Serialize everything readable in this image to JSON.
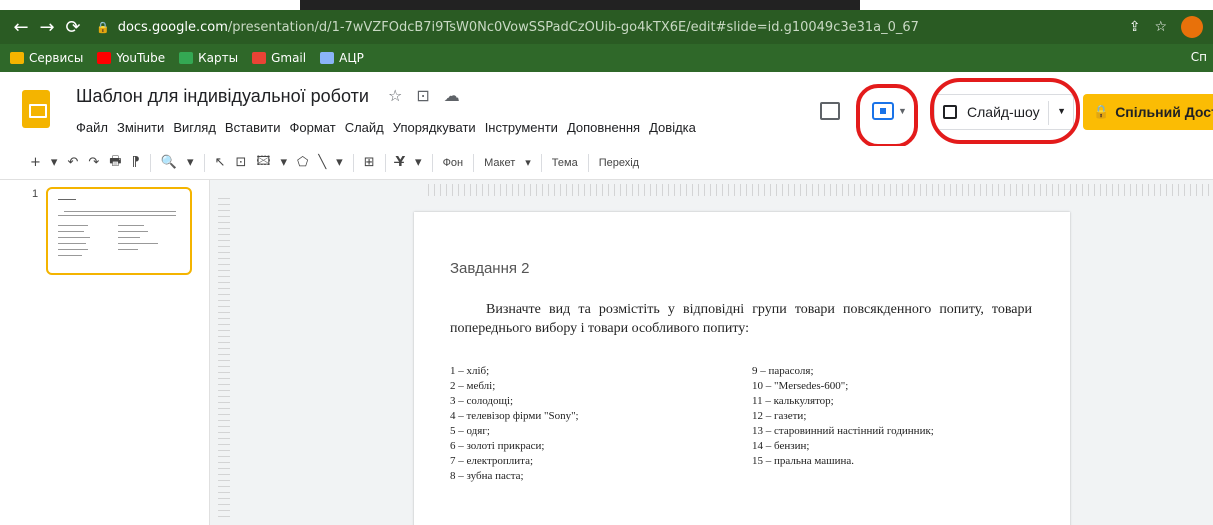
{
  "browser": {
    "url_host": "docs.google.com",
    "url_path": "/presentation/d/1-7wVZFOdcB7i9TsW0Nc0VowSSPadCzOUib-go4kTX6E/edit#slide=id.g10049c3e31a_0_67",
    "bookmarks": [
      {
        "label": "Сервисы",
        "icon": "apps-icon",
        "color": "#f4b400"
      },
      {
        "label": "YouTube",
        "icon": "youtube-icon",
        "color": "#ff0000"
      },
      {
        "label": "Карты",
        "icon": "maps-icon",
        "color": "#34a853"
      },
      {
        "label": "Gmail",
        "icon": "gmail-icon",
        "color": "#ea4335"
      },
      {
        "label": "АЦР",
        "icon": "site-icon",
        "color": "#8ab4f8"
      }
    ],
    "bookmarks_right_label": "Сп"
  },
  "docs": {
    "title": "Шаблон для індивідуальної роботи",
    "menu": [
      "Файл",
      "Змінити",
      "Вигляд",
      "Вставити",
      "Формат",
      "Слайд",
      "Упорядкувати",
      "Інструменти",
      "Доповнення",
      "Довідка"
    ],
    "slideshow_label": "Слайд-шоу",
    "share_label": "Спільний Досту",
    "accent": "#f4b400",
    "annotation_color": "#e31b1b"
  },
  "toolbar": {
    "glyphs": [
      "+",
      "▾",
      "↶",
      "↷",
      "🖶",
      "⁋",
      "🔍",
      "▾",
      "↖",
      "⊡",
      "🖾",
      "▾",
      "⬠",
      "╲",
      "▾",
      "⊞",
      "Y̶",
      "▾"
    ],
    "background_label": "Фон",
    "layout_label": "Макет",
    "theme_label": "Тема",
    "transition_label": "Перехід"
  },
  "filmstrip": {
    "slide_number": "1"
  },
  "slide": {
    "heading": "Завдання 2",
    "body": "Визначте вид та розмістіть у відповідні групи товари повсякденного попиту, товари попереднього вибору і товари особливого попиту:",
    "items_left": [
      "1 – хліб;",
      "2 – меблі;",
      "3 – солодощі;",
      "4 – телевізор фірми \"Sony\";",
      "5 – одяг;",
      "6 – золоті прикраси;",
      "7 – електроплита;",
      "8 – зубна паста;"
    ],
    "items_right": [
      "9 – парасоля;",
      "10 – \"Mersedes-600\";",
      "11 – калькулятор;",
      "12 – газети;",
      "13 – старовинний настінний годинник;",
      "14 – бензин;",
      "15 – пральна машина."
    ]
  }
}
